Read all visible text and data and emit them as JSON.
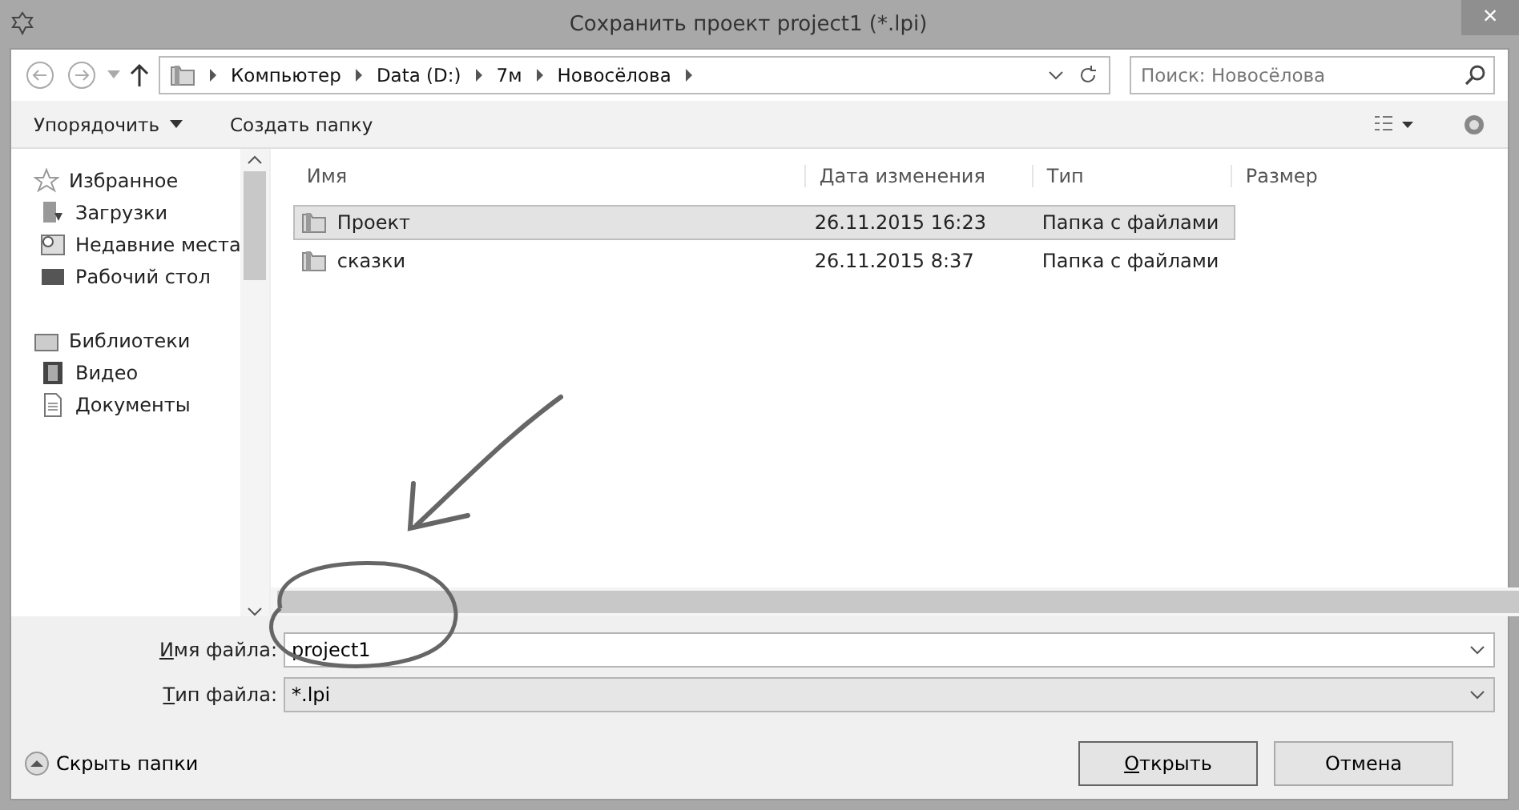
{
  "window": {
    "title": "Сохранить проект project1 (*.lpi)",
    "close": "×"
  },
  "address": {
    "crumbs": [
      "Компьютер",
      "Data (D:)",
      "7м",
      "Новосёлова"
    ]
  },
  "search": {
    "placeholder": "Поиск: Новосёлова"
  },
  "toolbar": {
    "organize": "Упорядочить",
    "new_folder": "Создать папку"
  },
  "sidebar": {
    "groups": [
      {
        "label": "Избранное",
        "items": [
          "Загрузки",
          "Недавние места",
          "Рабочий стол"
        ]
      },
      {
        "label": "Библиотеки",
        "items": [
          "Видео",
          "Документы"
        ]
      }
    ]
  },
  "table": {
    "columns": [
      "Имя",
      "Дата изменения",
      "Тип",
      "Размер"
    ],
    "rows": [
      {
        "name": "Проект",
        "date": "26.11.2015 16:23",
        "type": "Папка с файлами",
        "selected": true
      },
      {
        "name": "сказки",
        "date": "26.11.2015 8:37",
        "type": "Папка с файлами",
        "selected": false
      }
    ]
  },
  "form": {
    "fields": [
      {
        "label": "Имя файла:",
        "value": "project1",
        "editable": true
      },
      {
        "label": "Тип файла:",
        "value": "*.lpi",
        "editable": false
      }
    ]
  },
  "hide_folders": "Скрыть папки",
  "buttons": [
    {
      "label": "Открыть",
      "default": true
    },
    {
      "label": "Отмена",
      "default": false
    }
  ]
}
